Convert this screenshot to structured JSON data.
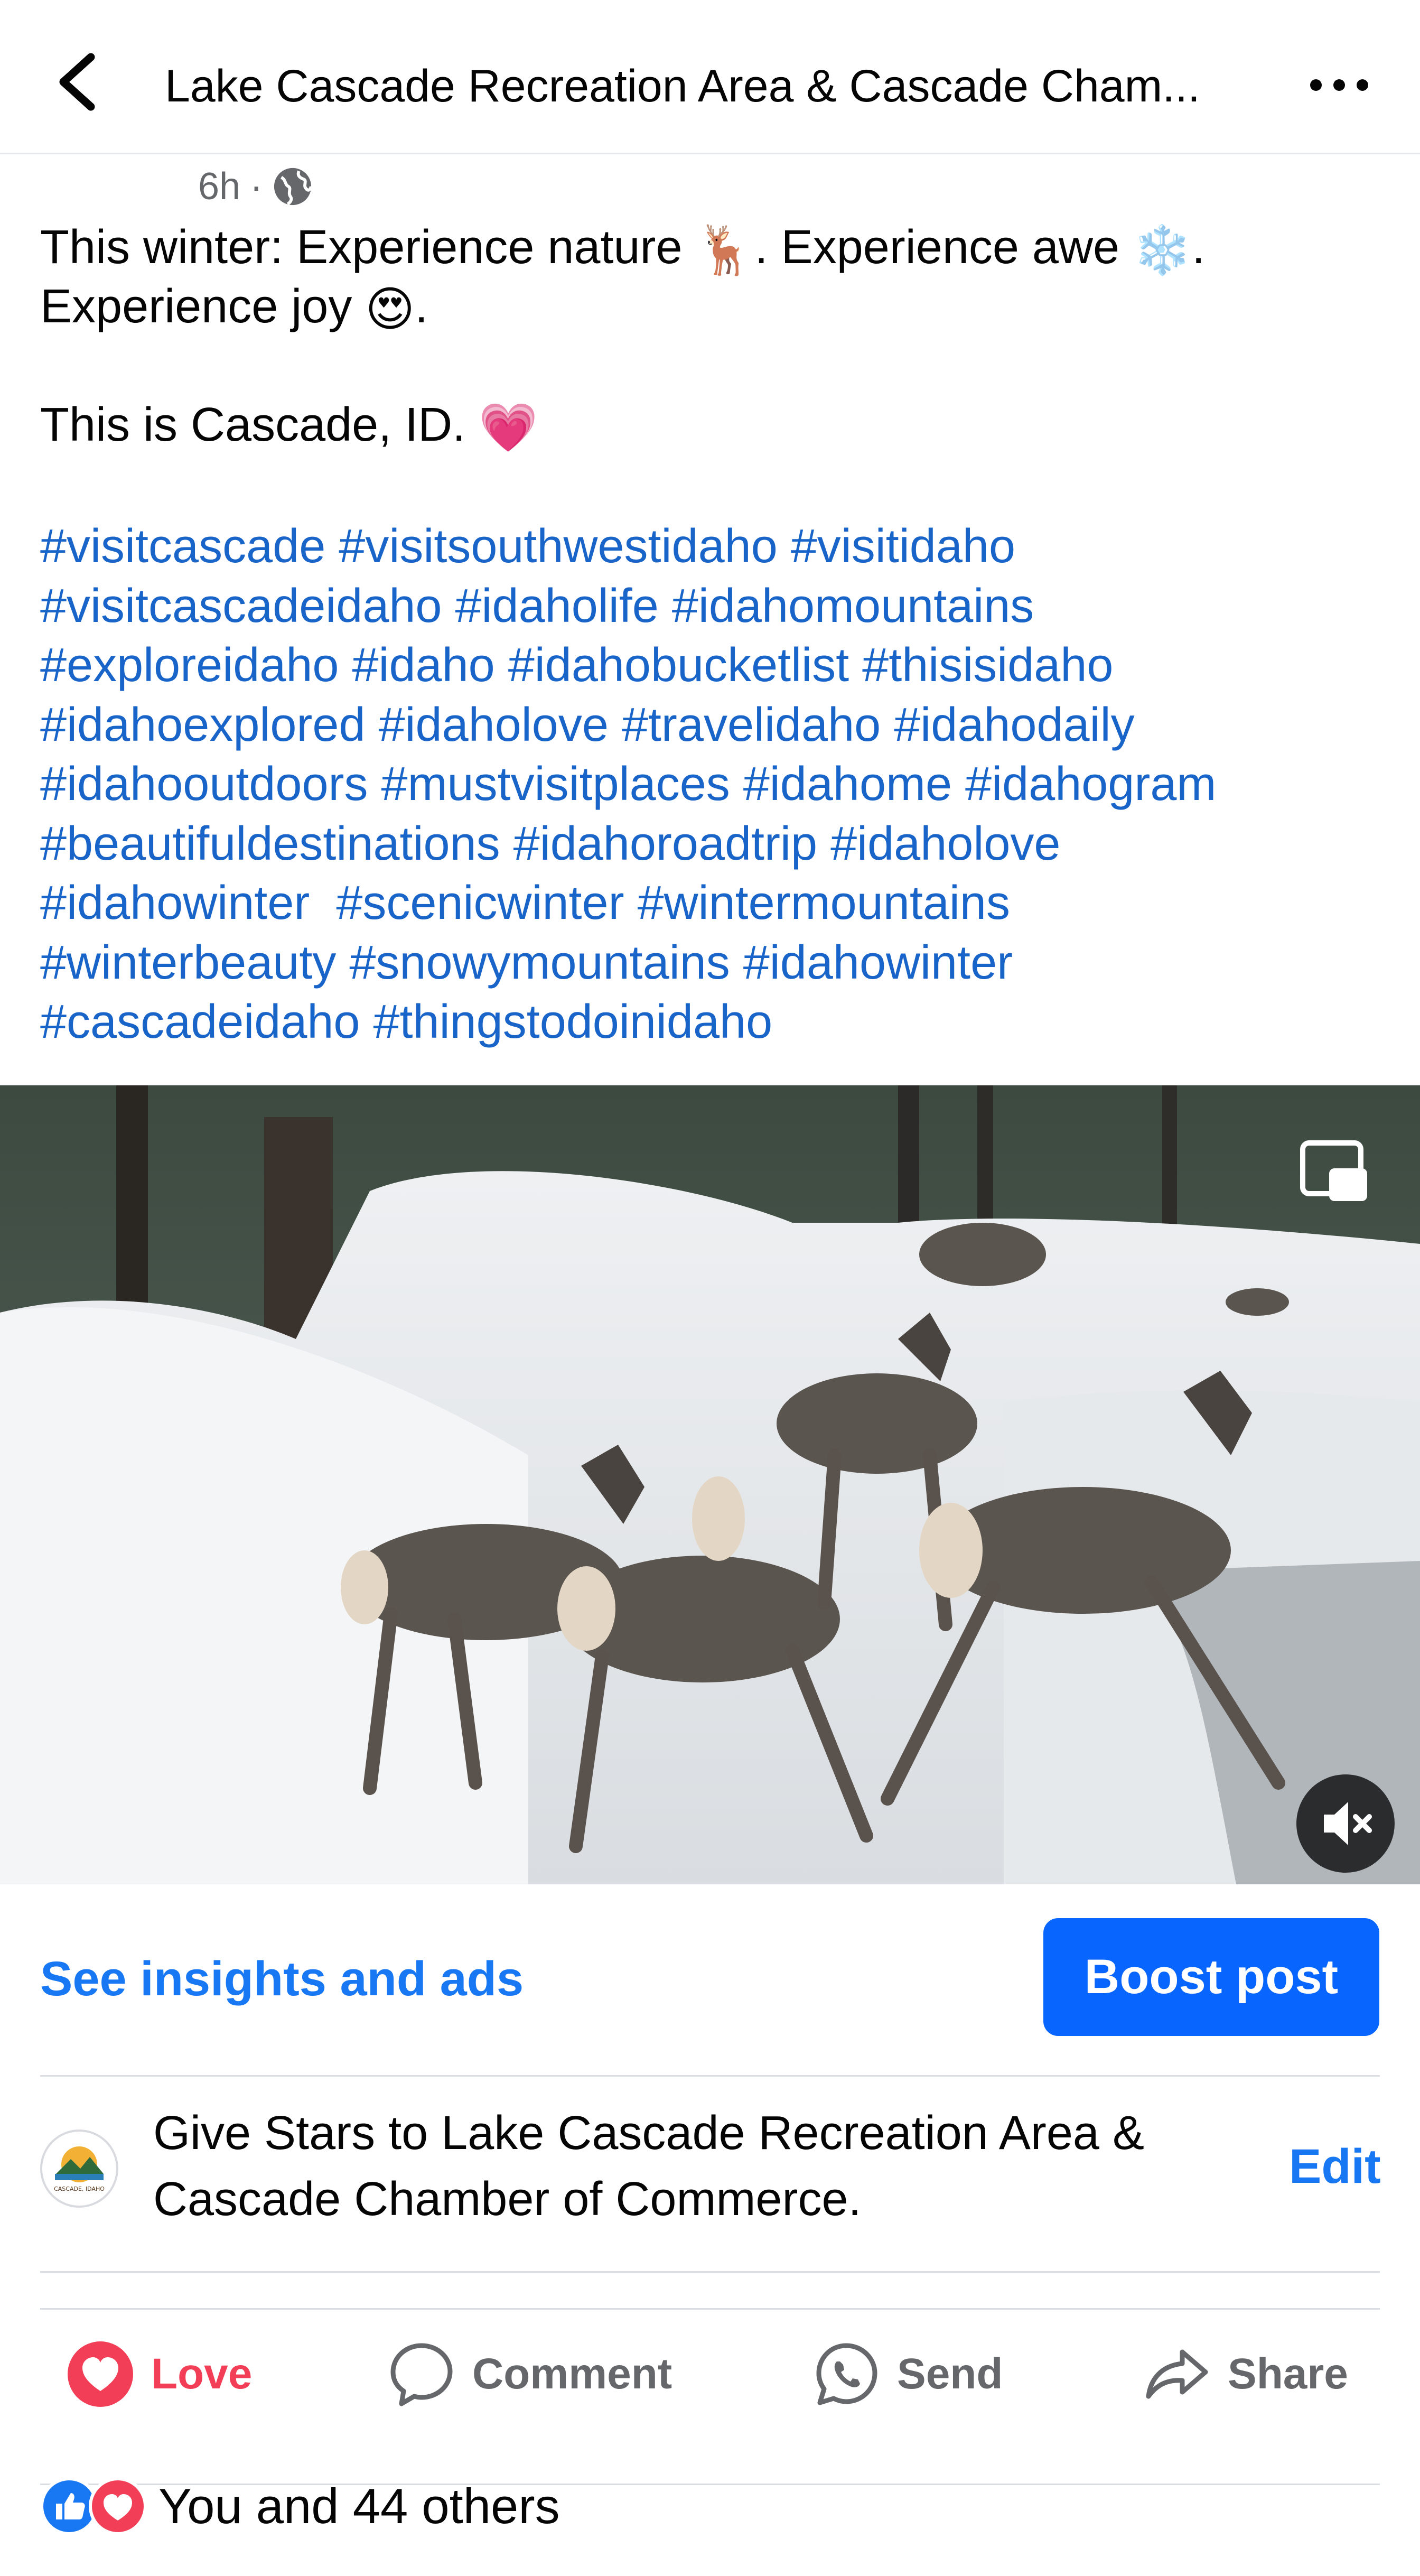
{
  "header": {
    "title": "Lake Cascade Recreation Area & Cascade Cham..."
  },
  "post": {
    "time": "6h",
    "separator": "·",
    "caption": {
      "line1_before": "This winter: Experience nature",
      "emoji_deer": "🦌",
      "line1_middle": ". Experience awe",
      "emoji_snow": "❄️",
      "line1_after": ".",
      "line2_before": "Experience joy",
      "emoji_heart_eyes": "😍",
      "line2_after": ".",
      "line3": "This is Cascade, ID.",
      "emoji_heart": "💗"
    },
    "hashtag_lines": [
      "#visitcascade #visitsouthwestidaho #visitidaho",
      "#visitcascadeidaho #idaholife #idahomountains",
      "#exploreidaho #idaho #idahobucketlist #thisisidaho",
      "#idahoexplored #idaholove #travelidaho #idahodaily",
      "#idahooutdoors #mustvisitplaces #idahome #idahogram",
      "#beautifuldestinations #idahoroadtrip #idaholove",
      "#idahowinter  #scenicwinter #wintermountains",
      "#winterbeauty #snowymountains #idahowinter",
      "#cascadeidaho #thingstodoinidaho"
    ]
  },
  "insights": {
    "link": "See insights and ads",
    "boost": "Boost post"
  },
  "stars": {
    "line1": "Give Stars to Lake Cascade Recreation Area &",
    "line2": "Cascade Chamber of Commerce.",
    "edit": "Edit",
    "avatar_text": "CASCADE, IDAHO"
  },
  "actions": {
    "love": "Love",
    "comment": "Comment",
    "send": "Send",
    "share": "Share"
  },
  "reactions": {
    "summary": "You and 44 others"
  },
  "colors": {
    "link_blue": "#1877f2",
    "hashtag_blue": "#1864c8",
    "boost_blue": "#0866ff",
    "love_red": "#f33e58"
  },
  "icons": [
    "back-arrow-icon",
    "more-icon",
    "globe-icon",
    "pip-icon",
    "mute-icon",
    "love-icon",
    "comment-icon",
    "whatsapp-icon",
    "share-icon",
    "like-reaction-icon",
    "love-reaction-icon"
  ]
}
